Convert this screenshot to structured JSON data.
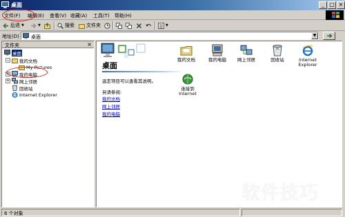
{
  "window": {
    "title": "桌面",
    "icon": "desktop-icon",
    "buttons": {
      "minimize": "_",
      "maximize": "□",
      "close": "×"
    }
  },
  "menu": {
    "items": [
      "文件(F)",
      "编辑(E)",
      "查看(V)",
      "收藏(A)",
      "工具(T)",
      "帮助(H)"
    ]
  },
  "toolbar": {
    "back": "后退",
    "forward_icon": "forward-arrow-icon",
    "up_icon": "up-folder-icon",
    "search": "搜索",
    "folders": "文件夹",
    "view_menu_icon": "views-icon"
  },
  "address": {
    "label": "地址(D)",
    "value": "桌面"
  },
  "folder_pane": {
    "title": "文件夹",
    "close": "×",
    "tree": [
      {
        "label": "桌面",
        "selected": true
      },
      {
        "label": "我的文档",
        "expander": "−"
      },
      {
        "label": "My Pictures"
      },
      {
        "label": "我的电脑",
        "expander": "+"
      },
      {
        "label": "网上邻居",
        "expander": "+"
      },
      {
        "label": "回收站"
      },
      {
        "label": "Internet Explorer"
      }
    ]
  },
  "content": {
    "heading": "桌面",
    "description": "选定项目可以查看其说明。",
    "see_also": "另请参阅:",
    "links": [
      "我的文档",
      "网上邻居",
      "我的电脑"
    ],
    "items": [
      {
        "label": "我的文档",
        "icon": "folder-icon"
      },
      {
        "label": "我的电脑",
        "icon": "computer-icon"
      },
      {
        "label": "网上邻居",
        "icon": "network-icon"
      },
      {
        "label": "回收站",
        "icon": "recycle-bin-icon"
      },
      {
        "label": "Internet\nExplorer",
        "icon": "ie-icon"
      },
      {
        "label": "连接到\nInternet",
        "icon": "connect-internet-icon"
      }
    ]
  },
  "status": {
    "count": "6 个对象"
  },
  "watermark": "软件技巧",
  "colors": {
    "titlebar_start": "#0a246a",
    "titlebar_end": "#a6caf0",
    "selection": "#0a246a",
    "link": "#0000cc",
    "annotation": "#e02020"
  }
}
